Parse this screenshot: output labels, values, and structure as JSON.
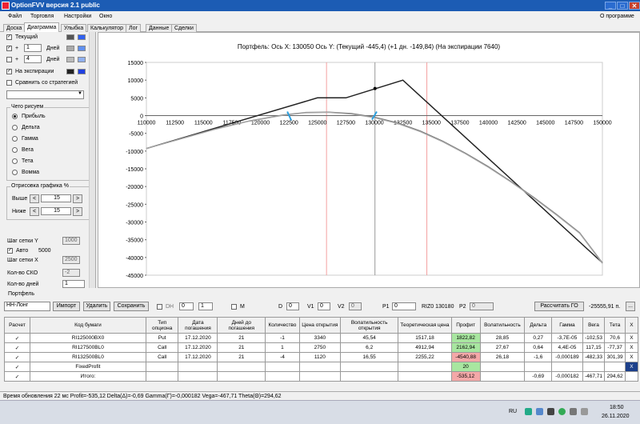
{
  "window": {
    "title": "OptionFVV версия 2.1 public",
    "about": "О программе",
    "close": "✕",
    "minimize": "_",
    "maximize": "□"
  },
  "menu": [
    "Файл",
    "Торговля",
    "Настройки",
    "Окно"
  ],
  "tabs": [
    "Доска",
    "Диаграмма",
    "Улыбка",
    "Калькулятор",
    "Лог",
    "Данные",
    "Сделки"
  ],
  "left": {
    "current": "Текущий",
    "plus": "+",
    "days": "Дней",
    "days1": "1",
    "days4": "4",
    "expiration": "На экспирации",
    "compare": "Сравнить со стратегией",
    "what_group": "Чего рисуем",
    "radios": [
      "Прибыль",
      "Дельта",
      "Гамма",
      "Вега",
      "Тета",
      "Вомма"
    ],
    "range_group": "Отрисовка графика %",
    "above": "Выше",
    "below": "Ниже",
    "above_val": "15",
    "below_val": "15",
    "prev": "<",
    "next": ">",
    "grid_y": "Шаг сетки Y",
    "grid_y_val": "1000",
    "auto": "Авто",
    "auto_val": "5000",
    "grid_x": "Шаг сетки X",
    "grid_x_val": "2500",
    "sko": "Кол-во СКО",
    "sko_val": "-2",
    "days_count": "Кол-во дней",
    "days_count_val": "1",
    "colors": {
      "current": [
        "#555555",
        "#3060f0"
      ],
      "plus1": [
        "#aaaaaa",
        "#6090f0"
      ],
      "plus4": [
        "#bbbbbb",
        "#90b0f0"
      ],
      "exp": [
        "#222222",
        "#2040e0"
      ]
    }
  },
  "chart_data": {
    "type": "line",
    "title": "Портфель:  Ось X: 130050  Ось Y:  (Текущий -445,4)  (+1 дн. -149,84)  (На экспирации 7640)",
    "xlim": [
      110000,
      150000
    ],
    "ylim": [
      -45000,
      15000
    ],
    "x_ticks": [
      110000,
      112500,
      115000,
      117500,
      120000,
      122500,
      125000,
      127500,
      130000,
      132500,
      135000,
      137500,
      140000,
      142500,
      145000,
      147500,
      150000
    ],
    "y_ticks": [
      15000,
      10000,
      5000,
      0,
      -5000,
      -10000,
      -15000,
      -20000,
      -25000,
      -30000,
      -35000,
      -40000,
      -45000
    ],
    "series": [
      {
        "color": "#222222",
        "points": [
          [
            110000,
            -9300
          ],
          [
            125000,
            5000
          ],
          [
            127500,
            5000
          ],
          [
            132500,
            10000
          ],
          [
            150000,
            -41500
          ]
        ]
      },
      {
        "color": "#777777",
        "points": [
          [
            110000,
            -9300
          ],
          [
            113000,
            -6500
          ],
          [
            116000,
            -3800
          ],
          [
            119000,
            -1500
          ],
          [
            122000,
            200
          ],
          [
            124000,
            900
          ],
          [
            126000,
            1000
          ],
          [
            128000,
            600
          ],
          [
            130000,
            -400
          ],
          [
            132000,
            -2000
          ],
          [
            134000,
            -4300
          ],
          [
            136000,
            -7200
          ],
          [
            138000,
            -10600
          ],
          [
            140000,
            -14400
          ],
          [
            142000,
            -18600
          ],
          [
            144000,
            -23100
          ],
          [
            146000,
            -27900
          ],
          [
            148000,
            -33000
          ],
          [
            150000,
            -41500
          ]
        ]
      },
      {
        "color": "#aaaaaa",
        "points": [
          [
            110000,
            -9300
          ],
          [
            113000,
            -6600
          ],
          [
            116000,
            -3900
          ],
          [
            119000,
            -1600
          ],
          [
            122000,
            100
          ],
          [
            124000,
            800
          ],
          [
            126000,
            900
          ],
          [
            128000,
            400
          ],
          [
            130000,
            -600
          ],
          [
            132000,
            -2200
          ],
          [
            134000,
            -4500
          ],
          [
            136000,
            -7400
          ],
          [
            138000,
            -10800
          ],
          [
            140000,
            -14600
          ],
          [
            142000,
            -18800
          ],
          [
            144000,
            -23300
          ],
          [
            146000,
            -28100
          ],
          [
            148000,
            -33200
          ],
          [
            150000,
            -41700
          ]
        ]
      }
    ],
    "vlines": [
      {
        "x": 125800,
        "color": "#f4a0a0"
      },
      {
        "x": 134600,
        "color": "#f4a0a0"
      },
      {
        "x": 130050,
        "color": "#999999"
      }
    ]
  },
  "portfolio": {
    "group": "Портфель",
    "name": "НН-Лонг",
    "import": "Импорт",
    "delete": "Удалить",
    "save": "Сохранить",
    "dh": "DH",
    "dh_a": "0",
    "dh_b": "1",
    "m": "M",
    "d": "D",
    "d_val": "0",
    "v1": "V1",
    "v1_val": "0",
    "v2": "V2",
    "v2_val": "0",
    "p1": "P1",
    "p1_val": "0",
    "ri": "RIZ0 130180",
    "p2": "P2",
    "p2_val": "0",
    "calc": "Рассчитать ГО",
    "go": "-25555,91 п.",
    "go_btn": "..."
  },
  "table": {
    "headers": [
      "Расчет",
      "Код бумаги",
      "Тип опциона",
      "Дата погашения",
      "Дней до погашения",
      "Количество",
      "Цена открытия",
      "Волатильность открытия",
      "Теоретическая цена",
      "Профит",
      "Волатильность",
      "Дельта",
      "Гамма",
      "Вега",
      "Тета",
      "X"
    ],
    "rows": [
      [
        "✓",
        "RI125000BX0",
        "Put",
        "17.12.2020",
        "21",
        "-1",
        "3340",
        "45,54",
        "1517,18",
        "1822,82",
        "28,85",
        "0,27",
        "-3,7E-05",
        "-102,53",
        "70,6",
        "X"
      ],
      [
        "✓",
        "RI127500BL0",
        "Call",
        "17.12.2020",
        "21",
        "1",
        "2750",
        "6,2",
        "4912,94",
        "2162,94",
        "27,67",
        "0,64",
        "4,4E-05",
        "117,15",
        "-77,37",
        "X"
      ],
      [
        "✓",
        "RI132500BL0",
        "Call",
        "17.12.2020",
        "21",
        "-4",
        "1120",
        "16,55",
        "2255,22",
        "-4540,88",
        "26,18",
        "-1,6",
        "-0,000189",
        "-482,33",
        "301,39",
        "X"
      ],
      [
        "✓",
        "FixedProfit",
        "",
        "",
        "",
        "",
        "",
        "",
        "",
        "20",
        "",
        "",
        "",
        "",
        "",
        "X"
      ],
      [
        "✓",
        "Итого:",
        "",
        "",
        "",
        "",
        "",
        "",
        "",
        "-535,12",
        "",
        "-0,69",
        "-0,000182",
        "-467,71",
        "294,62",
        ""
      ]
    ]
  },
  "status": "Время обновления 22 мс  Profit=-535,12 Delta(Δ)=-0,69 Gamma(Γ)=-0,000182 Vega=-467,71 Theta(Θ)=294,62",
  "taskbar": {
    "lang": "RU",
    "time": "18:50",
    "date": "26.11.2020"
  }
}
